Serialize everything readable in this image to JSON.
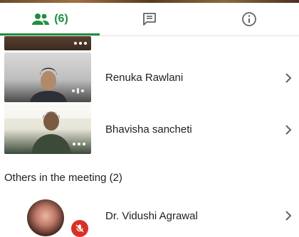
{
  "tabs": {
    "people_count": "(6)"
  },
  "participants": [
    {
      "name": "Renuka Rawlani"
    },
    {
      "name": "Bhavisha sancheti"
    }
  ],
  "others_section": {
    "label": "Others in the meeting (2)",
    "participants": [
      {
        "name": "Dr. Vidushi Agrawal"
      }
    ]
  },
  "colors": {
    "accent": "#1e8e3e",
    "muted_badge": "#d93025"
  },
  "icons": [
    "people-icon",
    "chat-icon",
    "info-icon",
    "chevron-right-icon",
    "more-dots-icon",
    "audio-level-icon",
    "mic-off-icon"
  ]
}
